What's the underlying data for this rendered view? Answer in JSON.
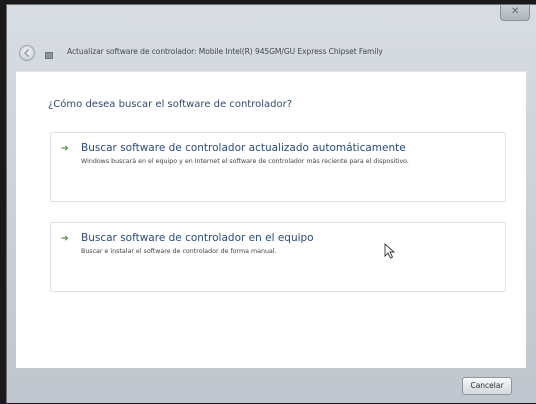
{
  "window": {
    "close_glyph": "✕"
  },
  "header": {
    "title": "Actualizar software de controlador: Mobile Intel(R) 945GM/GU Express Chipset Family",
    "back_icon": "back-arrow-icon",
    "device_icon": "device-icon"
  },
  "content": {
    "question": "¿Cómo desea buscar el software de controlador?",
    "options": [
      {
        "arrow": "➔",
        "title": "Buscar software de controlador actualizado automáticamente",
        "description": "Windows buscará en el equipo y en Internet el software de controlador más reciente para el dispositivo."
      },
      {
        "arrow": "➔",
        "title": "Buscar software de controlador en el equipo",
        "description": "Buscar e instalar el software de controlador de forma manual."
      }
    ]
  },
  "footer": {
    "cancel_label": "Cancelar"
  },
  "colors": {
    "link_blue": "#2a4b7c",
    "arrow_green": "#4a8a3a",
    "chrome": "#c9cfd5"
  }
}
